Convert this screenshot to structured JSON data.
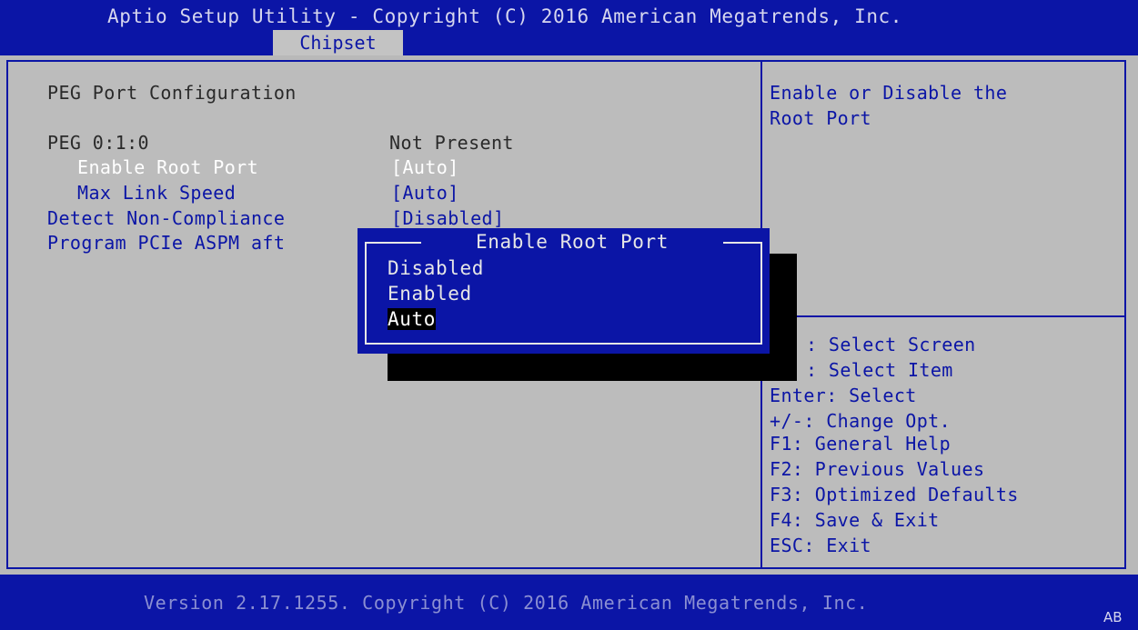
{
  "header": {
    "title": "Aptio Setup Utility - Copyright (C) 2016 American Megatrends, Inc.",
    "tab": "Chipset"
  },
  "main": {
    "section_title": "PEG Port Configuration",
    "rows": [
      {
        "label": "PEG 0:1:0",
        "value": "Not Present"
      },
      {
        "label": "Enable Root Port",
        "value": "[Auto]"
      },
      {
        "label": "Max Link Speed",
        "value": "[Auto]"
      },
      {
        "label": "Detect Non-Compliance",
        "value": "[Disabled]"
      },
      {
        "label": "Program PCIe ASPM aft",
        "value": ""
      }
    ]
  },
  "help": {
    "description": [
      "Enable or Disable the",
      "Root Port"
    ],
    "keys": [
      ": Select Screen",
      ": Select Item",
      "Enter: Select",
      "+/-: Change Opt.",
      "F1: General Help",
      "F2: Previous Values",
      "F3: Optimized Defaults",
      "F4: Save & Exit",
      "ESC: Exit"
    ]
  },
  "popup": {
    "title": "Enable Root Port",
    "options": [
      "Disabled",
      "Enabled",
      "Auto"
    ],
    "selected": "Auto"
  },
  "footer": {
    "version": "Version 2.17.1255. Copyright (C) 2016 American Megatrends, Inc.",
    "badge": "AB"
  },
  "colors": {
    "bios_blue": "#0b15a6",
    "panel_gray": "#bcbcbc",
    "shadow": "#000000"
  }
}
